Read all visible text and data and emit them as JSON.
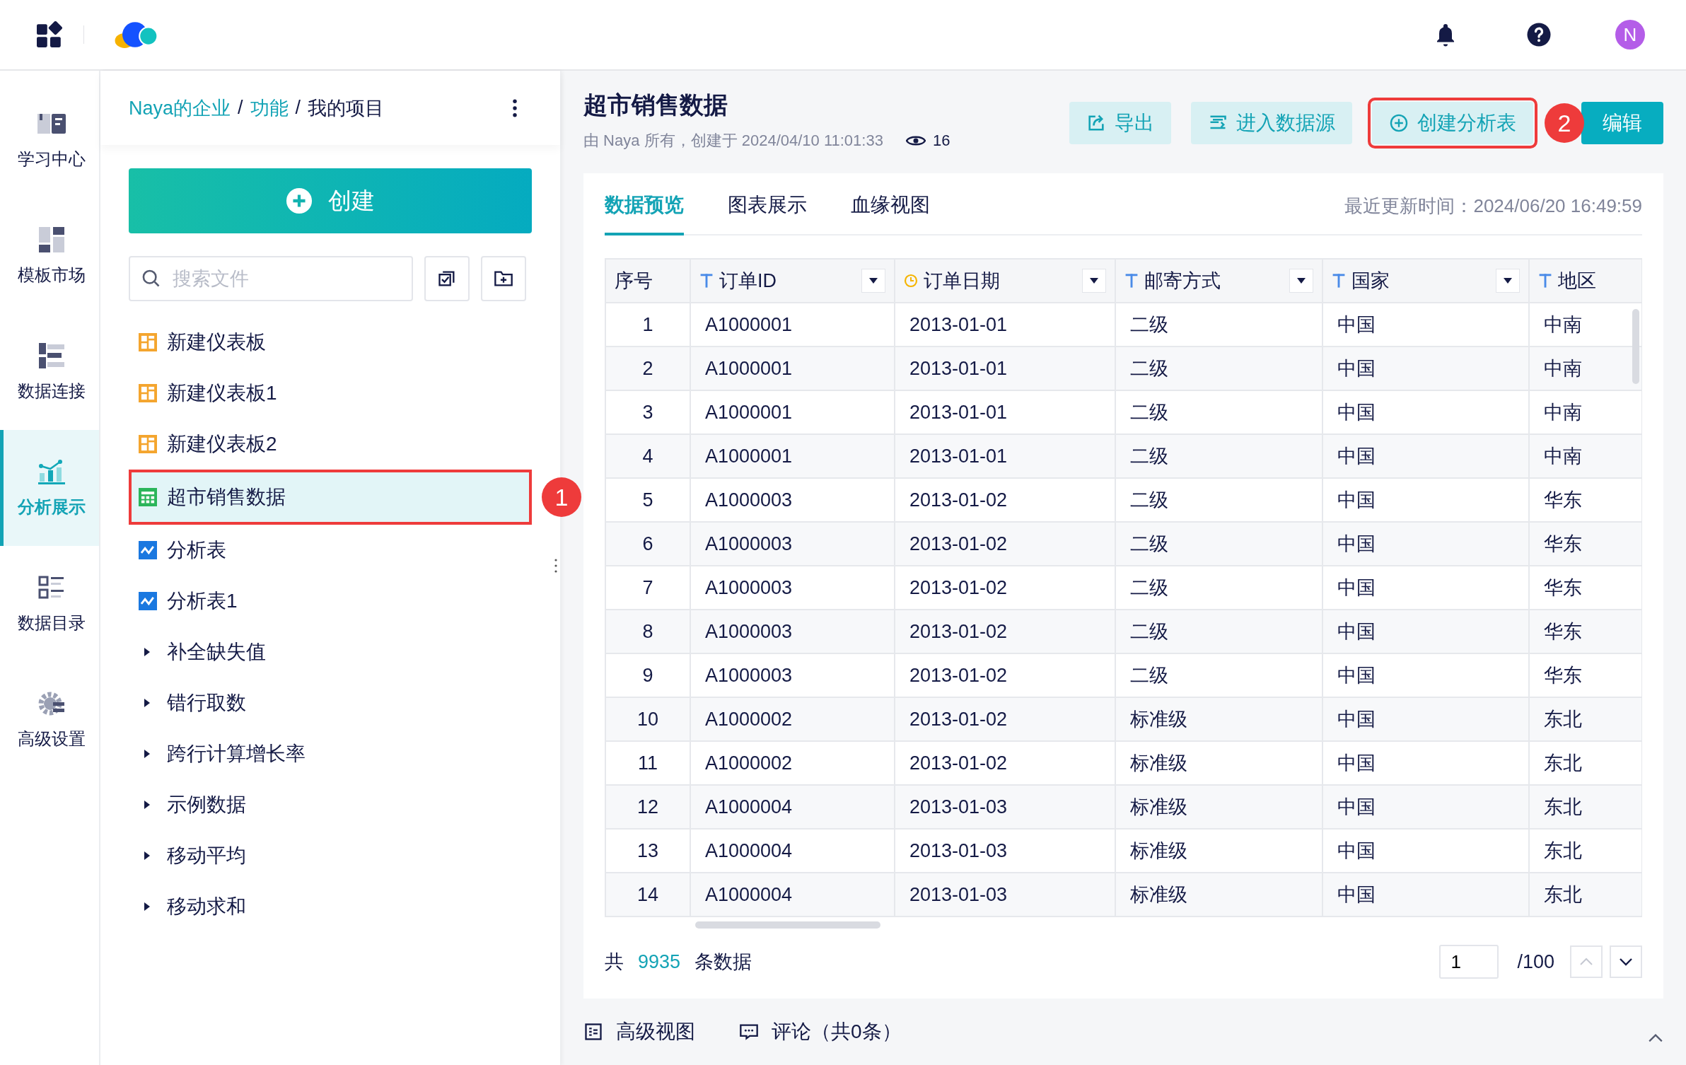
{
  "topbar": {
    "avatar": "N"
  },
  "nav": [
    {
      "label": "学习中心",
      "kind": "book",
      "selected": false
    },
    {
      "label": "模板市场",
      "kind": "template",
      "selected": false
    },
    {
      "label": "数据连接",
      "kind": "connect",
      "selected": false
    },
    {
      "label": "分析展示",
      "kind": "chart",
      "selected": true
    },
    {
      "label": "数据目录",
      "kind": "catalog",
      "selected": false
    },
    {
      "label": "高级设置",
      "kind": "settings",
      "selected": false
    }
  ],
  "breadcrumb": [
    {
      "label": "Naya的企业",
      "link": true
    },
    {
      "separator": "/",
      "label": "功能",
      "link": true
    },
    {
      "separator": "/",
      "label": "我的项目",
      "link": false
    }
  ],
  "create_button": "创建",
  "search": {
    "placeholder": "搜索文件"
  },
  "tree": [
    {
      "label": "新建仪表板",
      "kind": "dashboard",
      "selected": false,
      "annotated": false
    },
    {
      "label": "新建仪表板1",
      "kind": "dashboard",
      "selected": false,
      "annotated": false
    },
    {
      "label": "新建仪表板2",
      "kind": "dashboard",
      "selected": false,
      "annotated": false
    },
    {
      "label": "超市销售数据",
      "kind": "dataset",
      "selected": true,
      "annotated": true
    },
    {
      "label": "分析表",
      "kind": "analysis",
      "selected": false,
      "annotated": false
    },
    {
      "label": "分析表1",
      "kind": "analysis",
      "selected": false,
      "annotated": false
    },
    {
      "label": "补全缺失值",
      "kind": "folder",
      "expanded": false,
      "selected": false,
      "annotated": false
    },
    {
      "label": "错行取数",
      "kind": "folder",
      "expanded": false,
      "selected": false,
      "annotated": false
    },
    {
      "label": "跨行计算增长率",
      "kind": "folder",
      "expanded": false,
      "selected": false,
      "annotated": false
    },
    {
      "label": "示例数据",
      "kind": "folder",
      "expanded": false,
      "selected": false,
      "annotated": false
    },
    {
      "label": "移动平均",
      "kind": "folder",
      "expanded": false,
      "selected": false,
      "annotated": false
    },
    {
      "label": "移动求和",
      "kind": "folder",
      "expanded": false,
      "selected": false,
      "annotated": false
    }
  ],
  "callouts": [
    {
      "label": "1"
    },
    {
      "label": "2"
    }
  ],
  "dataset": {
    "title": "超市销售数据",
    "meta": "由 Naya 所有，创建于 2024/04/10 11:01:33",
    "views": "16"
  },
  "actions": [
    {
      "label": "导出",
      "kind": "export",
      "primary": false,
      "annotated": false
    },
    {
      "label": "进入数据源",
      "kind": "source",
      "primary": false,
      "annotated": false
    },
    {
      "label": "创建分析表",
      "kind": "create",
      "primary": false,
      "annotated": true
    },
    {
      "label": "编辑",
      "kind": "edit",
      "primary": true,
      "annotated": false
    }
  ],
  "tabs": [
    {
      "label": "数据预览",
      "selected": true
    },
    {
      "label": "图表展示",
      "selected": false
    },
    {
      "label": "血缘视图",
      "selected": false
    }
  ],
  "updated": "最近更新时间：2024/06/20 16:49:59",
  "table": {
    "columns": [
      {
        "label": "序号",
        "kind": "index"
      },
      {
        "label": "订单ID",
        "kind": "text"
      },
      {
        "label": "订单日期",
        "kind": "date"
      },
      {
        "label": "邮寄方式",
        "kind": "text"
      },
      {
        "label": "国家",
        "kind": "text"
      },
      {
        "label": "地区",
        "kind": "text"
      }
    ],
    "rows": [
      [
        "1",
        "A1000001",
        "2013-01-01",
        "二级",
        "中国",
        "中南"
      ],
      [
        "2",
        "A1000001",
        "2013-01-01",
        "二级",
        "中国",
        "中南"
      ],
      [
        "3",
        "A1000001",
        "2013-01-01",
        "二级",
        "中国",
        "中南"
      ],
      [
        "4",
        "A1000001",
        "2013-01-01",
        "二级",
        "中国",
        "中南"
      ],
      [
        "5",
        "A1000003",
        "2013-01-02",
        "二级",
        "中国",
        "华东"
      ],
      [
        "6",
        "A1000003",
        "2013-01-02",
        "二级",
        "中国",
        "华东"
      ],
      [
        "7",
        "A1000003",
        "2013-01-02",
        "二级",
        "中国",
        "华东"
      ],
      [
        "8",
        "A1000003",
        "2013-01-02",
        "二级",
        "中国",
        "华东"
      ],
      [
        "9",
        "A1000003",
        "2013-01-02",
        "二级",
        "中国",
        "华东"
      ],
      [
        "10",
        "A1000002",
        "2013-01-02",
        "标准级",
        "中国",
        "东北"
      ],
      [
        "11",
        "A1000002",
        "2013-01-02",
        "标准级",
        "中国",
        "东北"
      ],
      [
        "12",
        "A1000004",
        "2013-01-03",
        "标准级",
        "中国",
        "东北"
      ],
      [
        "13",
        "A1000004",
        "2013-01-03",
        "标准级",
        "中国",
        "东北"
      ],
      [
        "14",
        "A1000004",
        "2013-01-03",
        "标准级",
        "中国",
        "东北"
      ]
    ]
  },
  "pagination": {
    "prefix": "共",
    "total": "9935",
    "suffix": "条数据",
    "page": "1",
    "pages": "/100"
  },
  "footer": [
    {
      "label": "高级视图",
      "kind": "view"
    },
    {
      "label": "评论（共0条）",
      "kind": "comment"
    }
  ]
}
